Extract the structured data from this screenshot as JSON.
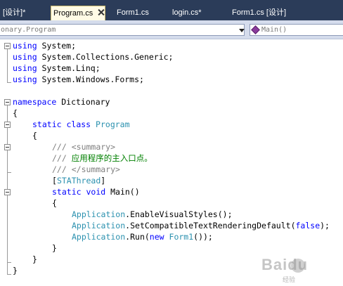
{
  "tabs": [
    {
      "label": "[设计]*",
      "active": false
    },
    {
      "label": "Program.cs",
      "active": true
    },
    {
      "label": "Form1.cs",
      "active": false
    },
    {
      "label": "login.cs*",
      "active": false
    },
    {
      "label": "Form1.cs [设计]",
      "active": false
    }
  ],
  "navbar": {
    "type_selector": "onary.Program",
    "member_selector": "Main()",
    "member_icon": "method-icon"
  },
  "code": {
    "l1": {
      "kw": "using",
      "rest": " System;"
    },
    "l2": {
      "kw": "using",
      "rest": " System.Collections.Generic;"
    },
    "l3": {
      "kw": "using",
      "rest": " System.Linq;"
    },
    "l4": {
      "kw": "using",
      "rest": " System.Windows.Forms;"
    },
    "l6": {
      "kw": "namespace",
      "rest": " Dictionary"
    },
    "l7": {
      "text": "{"
    },
    "l8": {
      "kw1": "static",
      "kw2": "class",
      "type": "Program"
    },
    "l9": {
      "text": "{"
    },
    "l10": {
      "slashes": "///",
      "doc": "<summary>"
    },
    "l11": {
      "slashes": "///",
      "comment": "应用程序的主入口点。"
    },
    "l12": {
      "slashes": "///",
      "doc": "</summary>"
    },
    "l13": {
      "open": "[",
      "type": "STAThread",
      "close": "]"
    },
    "l14": {
      "kw1": "static",
      "kw2": "void",
      "rest": " Main()"
    },
    "l15": {
      "text": "{"
    },
    "l16": {
      "type": "Application",
      "rest": ".EnableVisualStyles();"
    },
    "l17": {
      "type": "Application",
      "rest": ".SetCompatibleTextRenderingDefault(",
      "kw": "false",
      "end": ");"
    },
    "l18": {
      "type": "Application",
      "rest": ".Run(",
      "kw": "new",
      "type2": "Form1",
      "end": "());"
    },
    "l19": {
      "text": "}"
    },
    "l20": {
      "text": "}"
    },
    "l21": {
      "text": "}"
    }
  },
  "watermark": {
    "text": "Baidu",
    "sub": "经验"
  },
  "colors": {
    "keyword": "#0000ff",
    "type": "#2b91af",
    "comment": "#008000",
    "xmldoc": "#808080",
    "tabstrip": "#2b3c59",
    "active_tab": "#fffbe6"
  }
}
